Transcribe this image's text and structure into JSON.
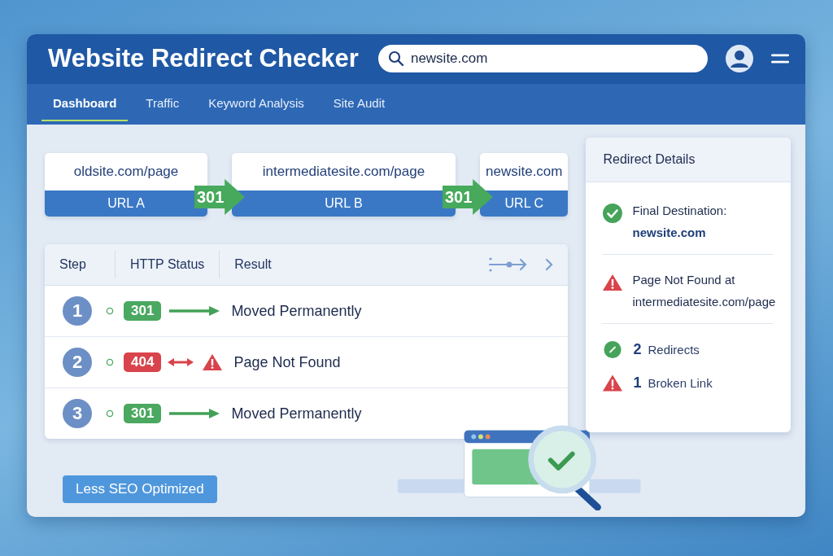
{
  "app": {
    "title": "Website Redirect Checker",
    "search": {
      "value": "newsite.com"
    }
  },
  "tabs": [
    {
      "label": "Dashboard",
      "selected": true
    },
    {
      "label": "Traffic",
      "selected": false
    },
    {
      "label": "Keyword Analysis",
      "selected": false
    },
    {
      "label": "Site Audit",
      "selected": false
    }
  ],
  "chain": {
    "urls": [
      {
        "url": "oldsite.com/page",
        "label": "URL A"
      },
      {
        "url": "intermediatesite.com/page",
        "label": "URL B"
      },
      {
        "url": "newsite.com",
        "label": "URL C"
      }
    ],
    "hops": [
      "301",
      "301"
    ]
  },
  "table": {
    "columns": [
      "Step",
      "HTTP Status",
      "Result"
    ],
    "rows": [
      {
        "step": "1",
        "code": "301",
        "kind": "ok",
        "result": "Moved Permanently"
      },
      {
        "step": "2",
        "code": "404",
        "kind": "error",
        "result": "Page Not Found"
      },
      {
        "step": "3",
        "code": "301",
        "kind": "ok",
        "result": "Moved Permanently"
      }
    ]
  },
  "details": {
    "title": "Redirect Details",
    "items": [
      {
        "kind": "success",
        "text": "Final Destination:",
        "value": "newsite.com"
      },
      {
        "kind": "warning",
        "text": "Page Not Found at",
        "value": "intermediatesite.com/page"
      }
    ],
    "summary": [
      {
        "kind": "success",
        "count": "2",
        "label": "Redirects"
      },
      {
        "kind": "warning",
        "count": "1",
        "label": "Broken Link"
      }
    ]
  },
  "badge": "Less SEO Optimized"
}
